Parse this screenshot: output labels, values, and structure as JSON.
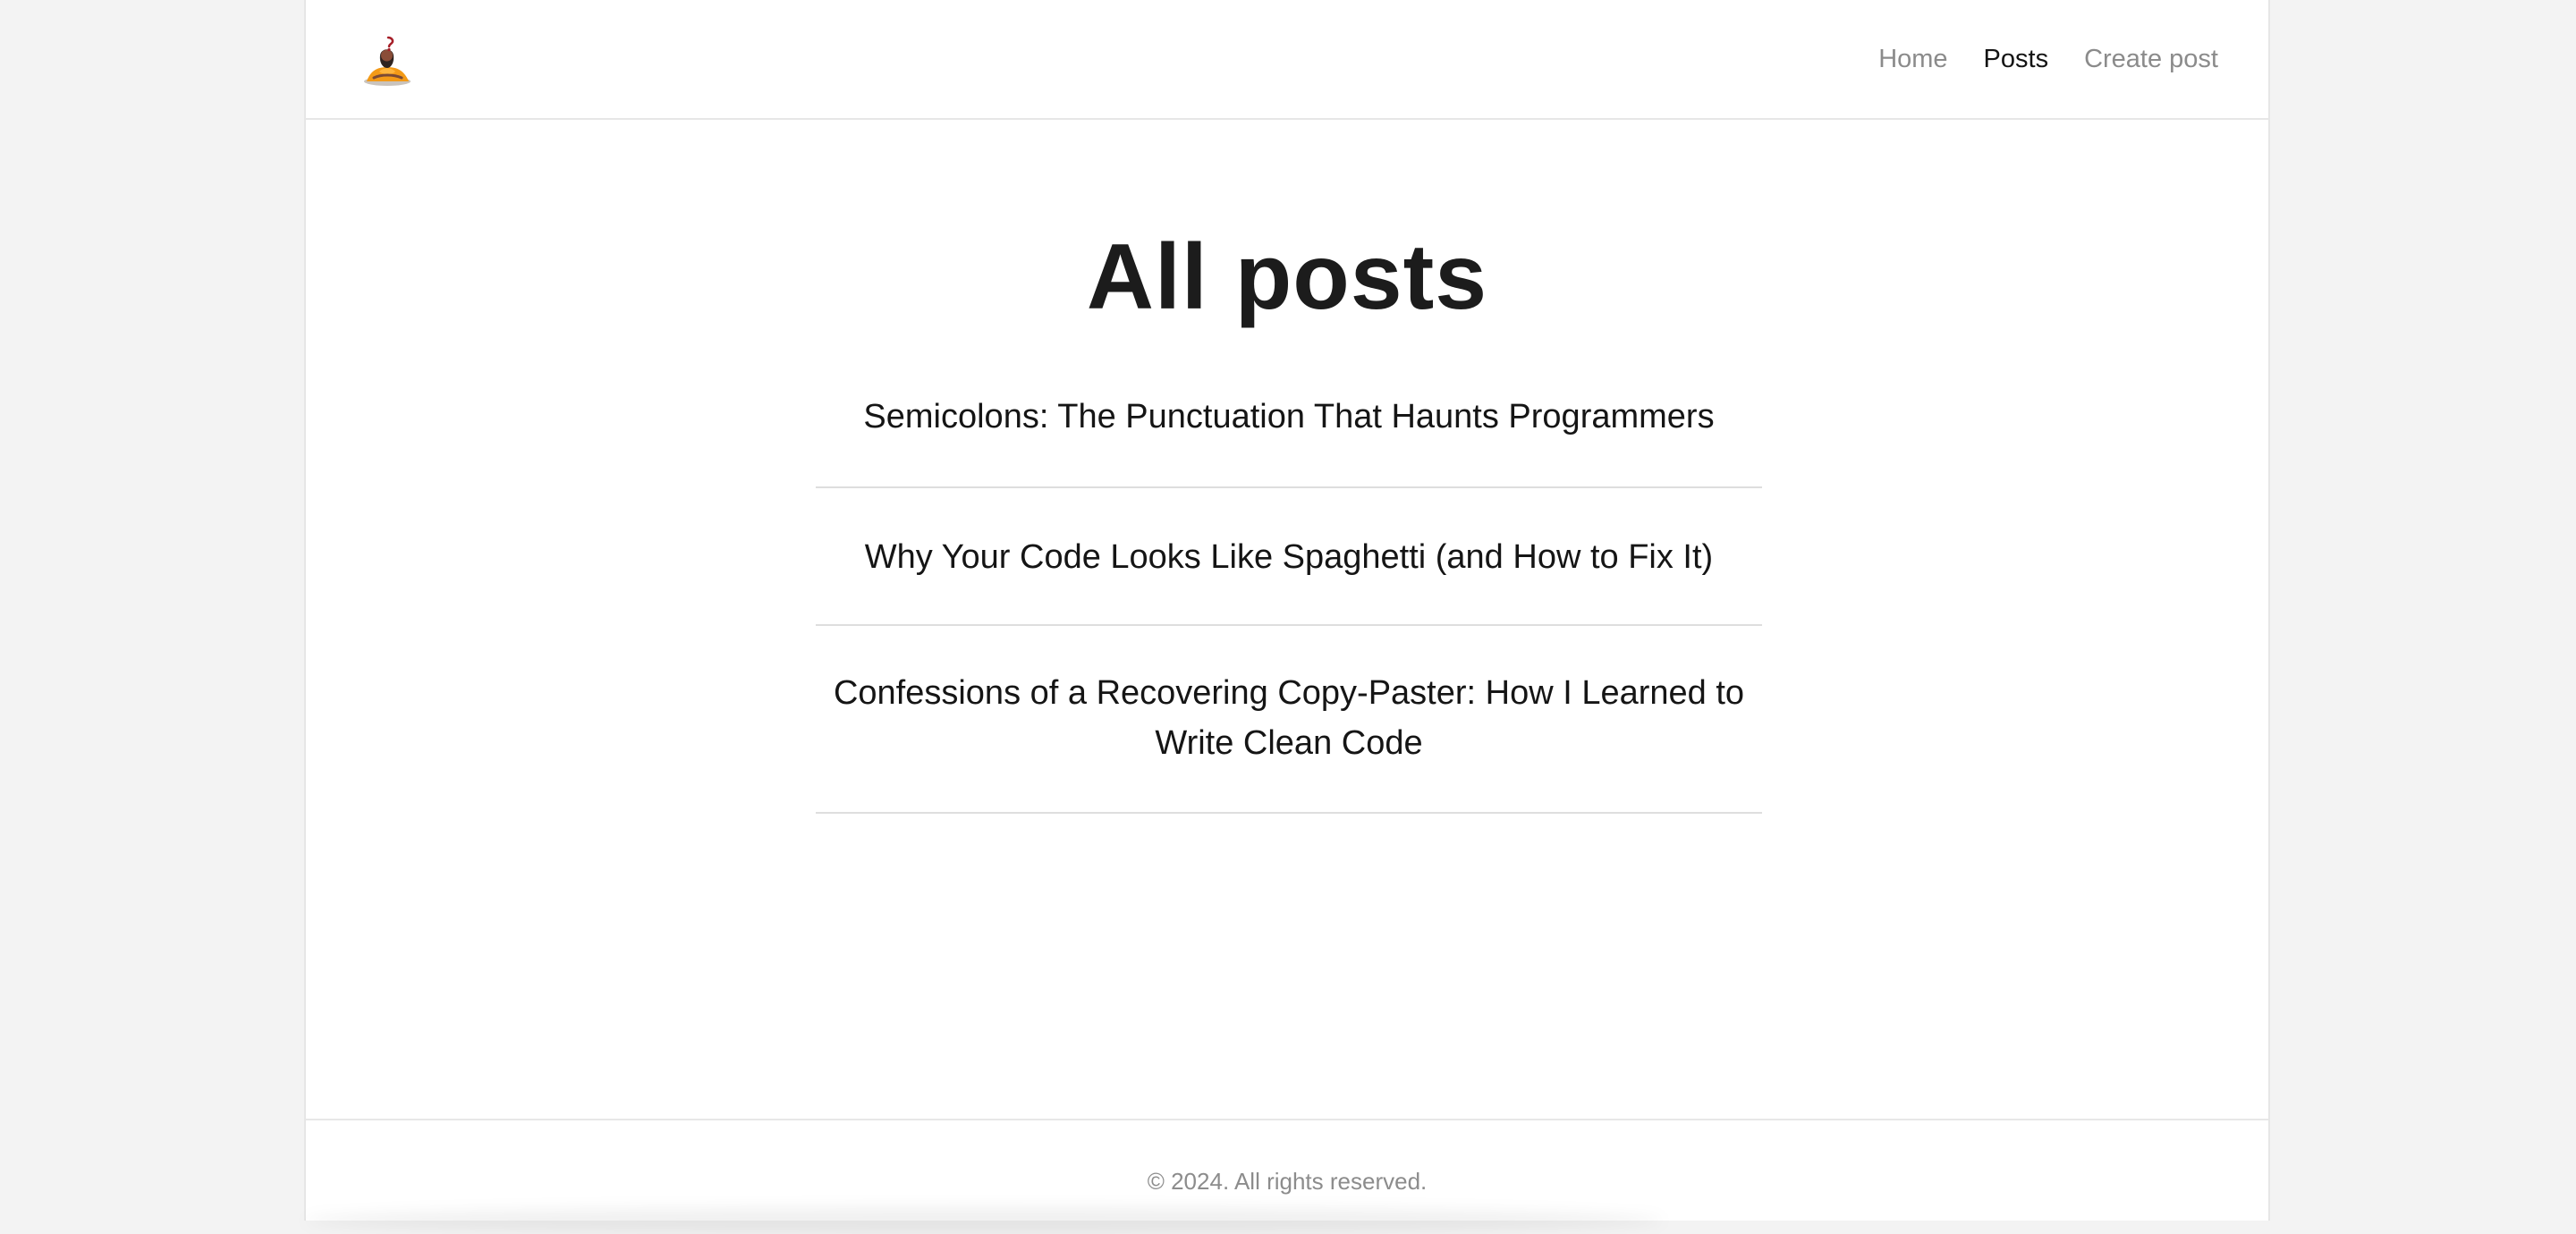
{
  "nav": {
    "items": [
      {
        "label": "Home"
      },
      {
        "label": "Posts"
      },
      {
        "label": "Create post"
      }
    ]
  },
  "page": {
    "title": "All posts"
  },
  "posts": [
    {
      "title": "Semicolons: The Punctuation That Haunts Programmers"
    },
    {
      "title": "Why Your Code Looks Like Spaghetti (and How to Fix It)"
    },
    {
      "title": "Confessions of a Recovering Copy-Paster: How I Learned to Write Clean Code"
    }
  ],
  "footer": {
    "copyright": "© 2024. All rights reserved."
  },
  "theme": {
    "background": "#f3f3f3",
    "surface": "#ffffff",
    "text": "#151515",
    "muted": "#8b8b8b"
  },
  "icons": {
    "logo": "meditating-person-icon"
  }
}
